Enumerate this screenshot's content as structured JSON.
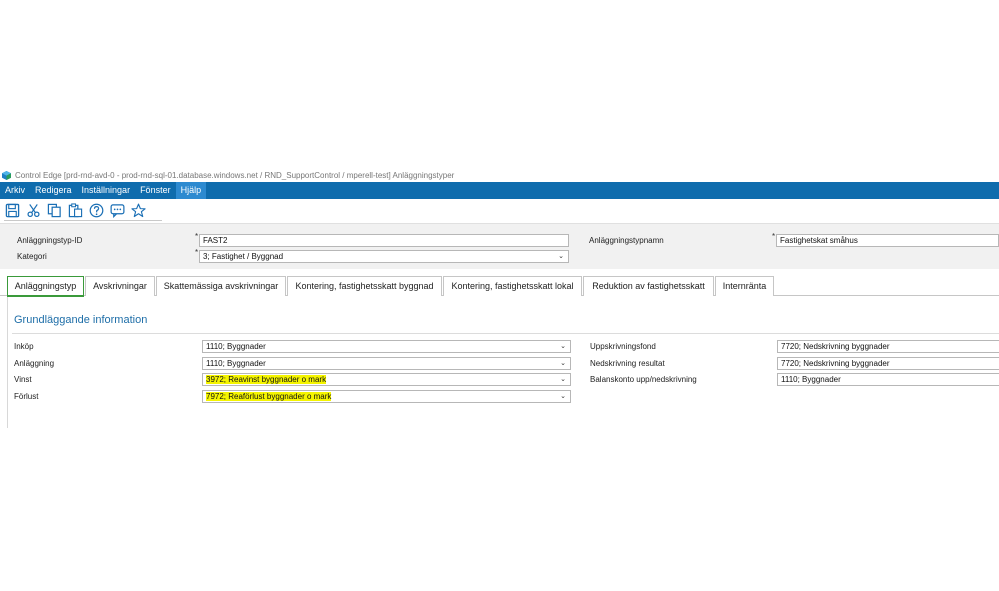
{
  "window": {
    "title": "Control Edge [prd-rnd-avd-0 - prod-rnd-sql-01.database.windows.net / RND_SupportControl / mperell-test] Anläggningstyper"
  },
  "menu": {
    "items": [
      "Arkiv",
      "Redigera",
      "Inställningar",
      "Fönster",
      "Hjälp"
    ]
  },
  "toolbar": {
    "icons": [
      "save-icon",
      "cut-icon",
      "copy-icon",
      "paste-icon",
      "help-icon",
      "comment-icon",
      "favorite-star-icon"
    ]
  },
  "header": {
    "id_label": "Anläggningstyp-ID",
    "id_value": "FAST2",
    "name_label": "Anläggningstypnamn",
    "name_value": "Fastighetskat småhus",
    "category_label": "Kategori",
    "category_value": "3; Fastighet / Byggnad",
    "required_mark": "*"
  },
  "tabs": [
    "Anläggningstyp",
    "Avskrivningar",
    "Skattemässiga avskrivningar",
    "Kontering, fastighetsskatt byggnad",
    "Kontering, fastighetsskatt lokal",
    "Reduktion av fastighetsskatt",
    "Internränta"
  ],
  "active_tab": "Anläggningstyp",
  "section": {
    "title": "Grundläggande information",
    "left": [
      {
        "label": "Inköp",
        "value": "1110; Byggnader",
        "highlighted": false
      },
      {
        "label": "Anläggning",
        "value": "1110; Byggnader",
        "highlighted": false
      },
      {
        "label": "Vinst",
        "value": "3972; Reavinst byggnader o mark",
        "highlighted": true
      },
      {
        "label": "Förlust",
        "value": "7972; Reaförlust byggnader o mark",
        "highlighted": true
      }
    ],
    "right": [
      {
        "label": "Uppskrivningsfond",
        "value": "7720; Nedskrivning byggnader"
      },
      {
        "label": "Nedskrivning resultat",
        "value": "7720; Nedskrivning byggnader"
      },
      {
        "label": "Balanskonto upp/nedskrivning",
        "value": "1110; Byggnader"
      }
    ]
  },
  "colors": {
    "menubar": "#0f6cad",
    "active_tab_border": "#3a9a3a",
    "section_title": "#1e6ea8",
    "highlight": "#f5f500"
  }
}
